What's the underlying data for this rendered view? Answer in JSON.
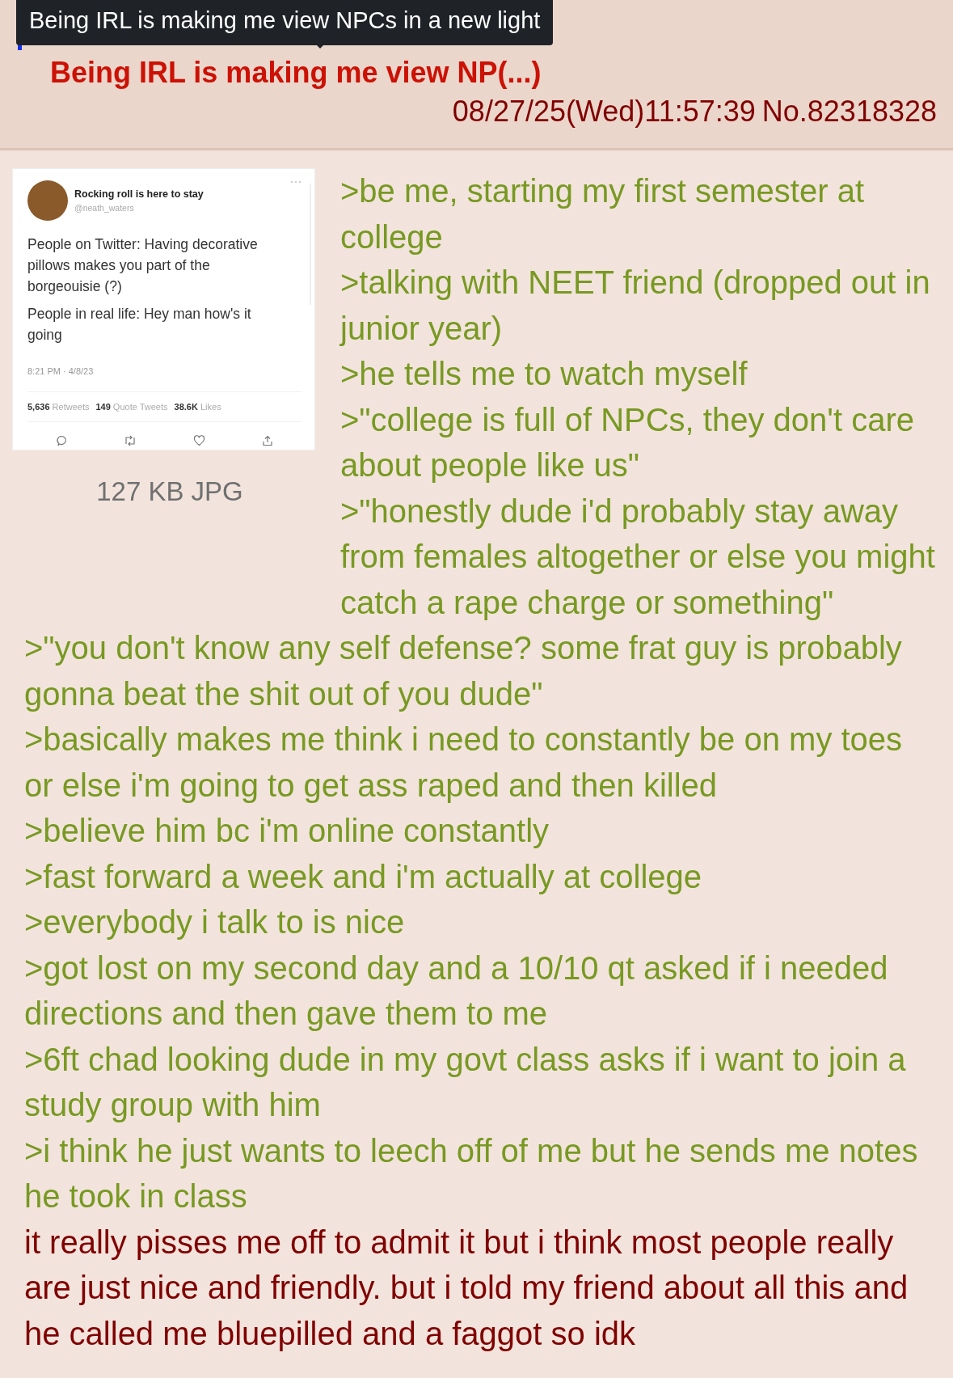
{
  "tooltip": {
    "text": "Being IRL is making me view NPCs in a new light"
  },
  "post": {
    "subject": "Being IRL is making me view NP(...)",
    "datetime": "08/27/25(Wed)11:57:39",
    "number": "No.82318328"
  },
  "file": {
    "info": "127 KB JPG",
    "tweet": {
      "display_name": "Rocking roll is here to stay",
      "handle": "@neath_waters",
      "paragraphs": [
        "People on Twitter: Having decorative pillows makes you part of the borgeouisie (?)",
        "People in real life: Hey man how's it going"
      ],
      "time": "8:21 PM · 4/8/23",
      "stats": [
        {
          "count": "5,636",
          "label": "Retweets"
        },
        {
          "count": "149",
          "label": "Quote Tweets"
        },
        {
          "count": "38.6K",
          "label": "Likes"
        }
      ]
    }
  },
  "lines": [
    {
      "kind": "quote",
      "text": ">be me, starting my first semester at college"
    },
    {
      "kind": "quote",
      "text": ">talking with NEET friend (dropped out in junior year)"
    },
    {
      "kind": "quote",
      "text": ">he tells me to watch myself"
    },
    {
      "kind": "quote",
      "text": ">\"college is full of NPCs, they don't care about people like us\""
    },
    {
      "kind": "quote",
      "text": ">\"honestly dude i'd probably stay away from females altogether or else you might catch a rape charge or something\""
    },
    {
      "kind": "quote",
      "text": ">\"you don't know any self defense? some frat guy is probably gonna beat the shit out of you dude\""
    },
    {
      "kind": "quote",
      "text": ">basically makes me think i need to constantly be on my toes or else i'm going to get ass raped and then killed"
    },
    {
      "kind": "quote",
      "text": ">believe him bc i'm online constantly"
    },
    {
      "kind": "quote",
      "text": ">fast forward a week and i'm actually at college"
    },
    {
      "kind": "quote",
      "text": ">everybody i talk to is nice"
    },
    {
      "kind": "quote",
      "text": ">got lost on my second day and a 10/10 qt asked if i needed directions and then gave them to me"
    },
    {
      "kind": "quote",
      "text": ">6ft chad looking dude in my govt class asks if i want to join a study group with him"
    },
    {
      "kind": "quote",
      "text": ">i think he just wants to leech off of me but he sends me notes he took in class"
    },
    {
      "kind": "plain",
      "text": "it really pisses me off to admit it but i think most people really are just nice and friendly. but i told my friend about all this and he called me bluepilled and a faggot so idk"
    }
  ]
}
